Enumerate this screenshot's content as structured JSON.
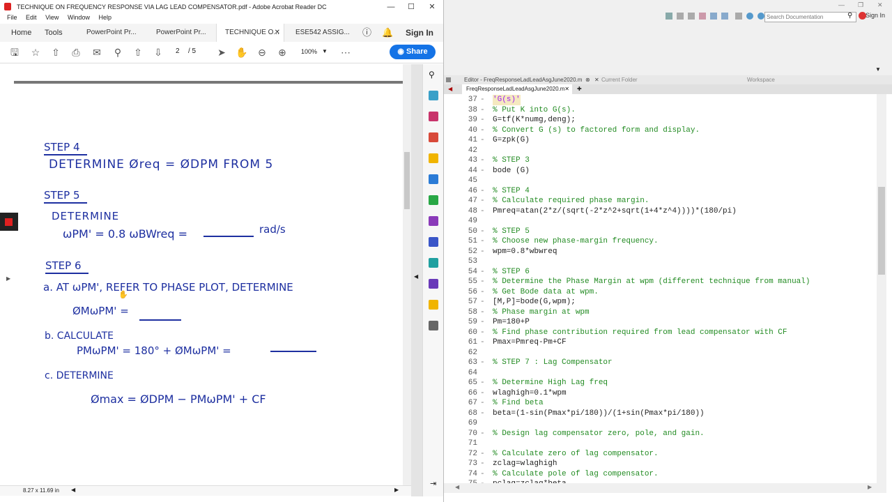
{
  "acrobat": {
    "title": "TECHNIQUE ON FREQUENCY RESPONSE VIA LAG LEAD COMPENSATOR.pdf - Adobe Acrobat Reader DC",
    "menu": [
      "File",
      "Edit",
      "View",
      "Window",
      "Help"
    ],
    "tabs": {
      "home": "Home",
      "tools": "Tools",
      "tab1": "PowerPoint Pr...",
      "tab2": "PowerPoint Pr...",
      "tab3": "TECHNIQUE O...",
      "tab4": "ESE542 ASSIG..."
    },
    "signin": "Sign In",
    "page_current": "2",
    "page_total": "/ 5",
    "zoom": "100%",
    "share": "Share",
    "page_size": "8.27 x 11.69 in"
  },
  "handwriting": {
    "step4_title": "STEP 4",
    "step4_text": "DETERMINE Øreq = ØDPM FROM 5",
    "step5_title": "STEP 5",
    "step5_determine": "DETERMINE",
    "step5_formula": "ωPM' = 0.8 ωBWreq =",
    "step5_unit": "rad/s",
    "step6_title": "STEP 6",
    "step6a": "a. AT ωPM', REFER TO PHASE PLOT, DETERMINE",
    "step6a_formula": "ØMωPM' =",
    "step6b": "b. CALCULATE",
    "step6b_formula": "PMωPM' = 180° + ØMωPM' =",
    "step6c": "c. DETERMINE",
    "step6c_formula": "Ømax = ØDPM − PMωPM' + CF"
  },
  "matlab": {
    "search_placeholder": "Search Documentation",
    "signin": "Sign In",
    "editor_title": "Editor - FreqResponseLadLeadAsgJune2020.m",
    "current_folder": "Current Folder",
    "workspace": "Workspace",
    "file_tab": "FreqResponseLadLeadAsgJune2020.m",
    "code_lines": [
      {
        "n": "37",
        "t": "'G(s)'",
        "c": "str"
      },
      {
        "n": "38",
        "t": "% Put K into G(s).",
        "c": "cm"
      },
      {
        "n": "39",
        "t": "G=tf(K*numg,deng);",
        "c": "kw"
      },
      {
        "n": "40",
        "t": "% Convert G (s) to factored form and display.",
        "c": "cm"
      },
      {
        "n": "41",
        "t": "G=zpk(G)",
        "c": "kw"
      },
      {
        "n": "42",
        "t": "",
        "c": "kw"
      },
      {
        "n": "43",
        "t": "% STEP 3",
        "c": "cm"
      },
      {
        "n": "44",
        "t": "bode (G)",
        "c": "kw"
      },
      {
        "n": "45",
        "t": "",
        "c": "kw"
      },
      {
        "n": "46",
        "t": "% STEP 4",
        "c": "cm"
      },
      {
        "n": "47",
        "t": "% Calculate required phase margin.",
        "c": "cm"
      },
      {
        "n": "48",
        "t": "Pmreq=atan(2*z/(sqrt(-2*z^2+sqrt(1+4*z^4))))*(180/pi)",
        "c": "kw"
      },
      {
        "n": "49",
        "t": "",
        "c": "kw"
      },
      {
        "n": "50",
        "t": "% STEP 5",
        "c": "cm"
      },
      {
        "n": "51",
        "t": "% Choose new phase-margin frequency.",
        "c": "cm"
      },
      {
        "n": "52",
        "t": "wpm=0.8*wbwreq",
        "c": "kw"
      },
      {
        "n": "53",
        "t": "",
        "c": "kw"
      },
      {
        "n": "54",
        "t": "% STEP 6",
        "c": "cm"
      },
      {
        "n": "55",
        "t": "% Determine the Phase Margin at wpm (different technique from manual)",
        "c": "cm"
      },
      {
        "n": "56",
        "t": "% Get Bode data at wpm.",
        "c": "cm"
      },
      {
        "n": "57",
        "t": "[M,P]=bode(G,wpm);",
        "c": "kw"
      },
      {
        "n": "58",
        "t": "% Phase margin at wpm",
        "c": "cm"
      },
      {
        "n": "59",
        "t": "Pm=180+P",
        "c": "kw"
      },
      {
        "n": "60",
        "t": "% Find phase contribution required from lead compensator with CF",
        "c": "cm"
      },
      {
        "n": "61",
        "t": "Pmax=Pmreq-Pm+CF",
        "c": "kw"
      },
      {
        "n": "62",
        "t": "",
        "c": "kw"
      },
      {
        "n": "63",
        "t": "% STEP 7 : Lag Compensator",
        "c": "cm"
      },
      {
        "n": "64",
        "t": "",
        "c": "kw"
      },
      {
        "n": "65",
        "t": "% Determine High Lag freq",
        "c": "cm"
      },
      {
        "n": "66",
        "t": "wlaghigh=0.1*wpm",
        "c": "kw"
      },
      {
        "n": "67",
        "t": "% Find beta",
        "c": "cm"
      },
      {
        "n": "68",
        "t": "beta=(1-sin(Pmax*pi/180))/(1+sin(Pmax*pi/180))",
        "c": "kw"
      },
      {
        "n": "69",
        "t": "",
        "c": "kw"
      },
      {
        "n": "70",
        "t": "% Design lag compensator zero, pole, and gain.",
        "c": "cm"
      },
      {
        "n": "71",
        "t": "",
        "c": "kw"
      },
      {
        "n": "72",
        "t": "% Calculate zero of lag compensator.",
        "c": "cm"
      },
      {
        "n": "73",
        "t": "zclag=wlaghigh",
        "c": "kw"
      },
      {
        "n": "74",
        "t": "% Calculate pole of lag compensator.",
        "c": "cm"
      },
      {
        "n": "75",
        "t": "pclag=zclag*beta",
        "c": "kw"
      }
    ]
  }
}
